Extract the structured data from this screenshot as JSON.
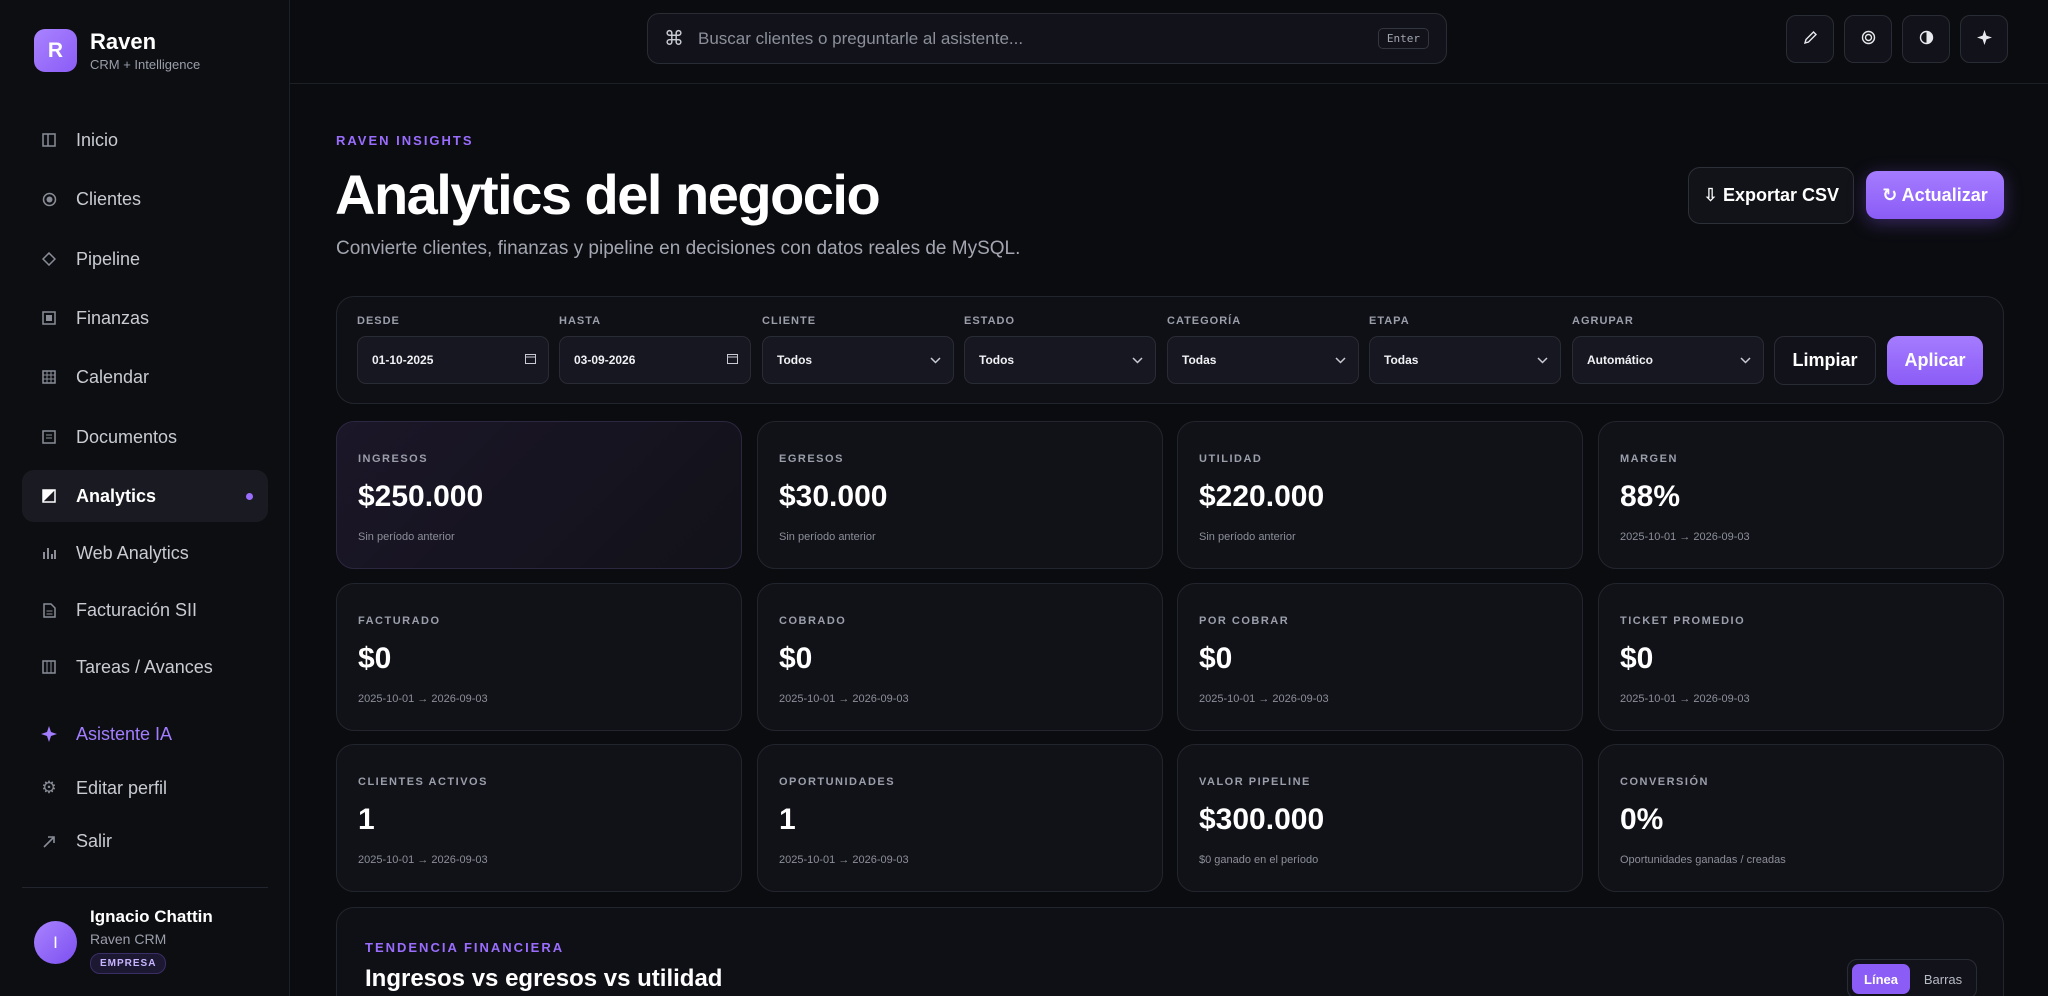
{
  "brand": {
    "logo_letter": "R",
    "name": "Raven",
    "tagline": "CRM + Intelligence"
  },
  "sidebar": {
    "items": [
      {
        "label": "Inicio",
        "icon": "layout-columns-icon"
      },
      {
        "label": "Clientes",
        "icon": "target-icon"
      },
      {
        "label": "Pipeline",
        "icon": "diamond-icon"
      },
      {
        "label": "Finanzas",
        "icon": "square-icon"
      },
      {
        "label": "Calendar",
        "icon": "calendar-grid-icon"
      },
      {
        "label": "Documentos",
        "icon": "document-list-icon"
      },
      {
        "label": "Analytics",
        "icon": "half-square-icon",
        "active": true
      },
      {
        "label": "Web Analytics",
        "icon": "bar-chart-icon"
      },
      {
        "label": "Facturación SII",
        "icon": "invoice-icon"
      },
      {
        "label": "Tareas / Avances",
        "icon": "tasks-grid-icon"
      }
    ],
    "assistant": {
      "label": "Asistente IA",
      "icon": "sparkle-icon"
    },
    "edit_profile": {
      "label": "Editar perfil",
      "icon": "gear-icon"
    },
    "logout": {
      "label": "Salir",
      "icon": "arrow-up-right-icon"
    }
  },
  "user": {
    "initial": "I",
    "name": "Ignacio Chattin",
    "company": "Raven CRM",
    "badge": "EMPRESA"
  },
  "search": {
    "placeholder": "Buscar clientes o preguntarle al asistente...",
    "shortcut": "Enter"
  },
  "toolbar": {
    "icons": [
      "pencil-icon",
      "circle-target-icon",
      "contrast-icon",
      "sparkle-icon"
    ]
  },
  "header": {
    "eyebrow": "RAVEN INSIGHTS",
    "title": "Analytics del negocio",
    "subtitle": "Convierte clientes, finanzas y pipeline en decisiones con datos reales de MySQL.",
    "export_label": "⇩ Exportar CSV",
    "refresh_label": "↻ Actualizar"
  },
  "filters": {
    "desde": {
      "label": "DESDE",
      "value": "01-10-2025"
    },
    "hasta": {
      "label": "HASTA",
      "value": "03-09-2026"
    },
    "cliente": {
      "label": "CLIENTE",
      "value": "Todos"
    },
    "estado": {
      "label": "ESTADO",
      "value": "Todos"
    },
    "categoria": {
      "label": "CATEGORÍA",
      "value": "Todas"
    },
    "etapa": {
      "label": "ETAPA",
      "value": "Todas"
    },
    "agrupar": {
      "label": "AGRUPAR",
      "value": "Automático"
    },
    "clear_label": "Limpiar",
    "apply_label": "Aplicar"
  },
  "kpis": [
    {
      "label": "INGRESOS",
      "value": "$250.000",
      "sub": "Sin período anterior"
    },
    {
      "label": "EGRESOS",
      "value": "$30.000",
      "sub": "Sin período anterior"
    },
    {
      "label": "UTILIDAD",
      "value": "$220.000",
      "sub": "Sin período anterior"
    },
    {
      "label": "MARGEN",
      "value": "88%",
      "sub": "2025-10-01 → 2026-09-03"
    },
    {
      "label": "FACTURADO",
      "value": "$0",
      "sub": "2025-10-01 → 2026-09-03"
    },
    {
      "label": "COBRADO",
      "value": "$0",
      "sub": "2025-10-01 → 2026-09-03"
    },
    {
      "label": "POR COBRAR",
      "value": "$0",
      "sub": "2025-10-01 → 2026-09-03"
    },
    {
      "label": "TICKET PROMEDIO",
      "value": "$0",
      "sub": "2025-10-01 → 2026-09-03"
    },
    {
      "label": "CLIENTES ACTIVOS",
      "value": "1",
      "sub": "2025-10-01 → 2026-09-03"
    },
    {
      "label": "OPORTUNIDADES",
      "value": "1",
      "sub": "2025-10-01 → 2026-09-03"
    },
    {
      "label": "VALOR PIPELINE",
      "value": "$300.000",
      "sub": "$0 ganado en el período"
    },
    {
      "label": "CONVERSIÓN",
      "value": "0%",
      "sub": "Oportunidades ganadas / creadas"
    }
  ],
  "trend": {
    "eyebrow": "TENDENCIA FINANCIERA",
    "title": "Ingresos vs egresos vs utilidad",
    "toggle_line": "Línea",
    "toggle_bars": "Barras"
  },
  "colors": {
    "accent": "#8b5cf6",
    "background": "#0b0c10"
  }
}
